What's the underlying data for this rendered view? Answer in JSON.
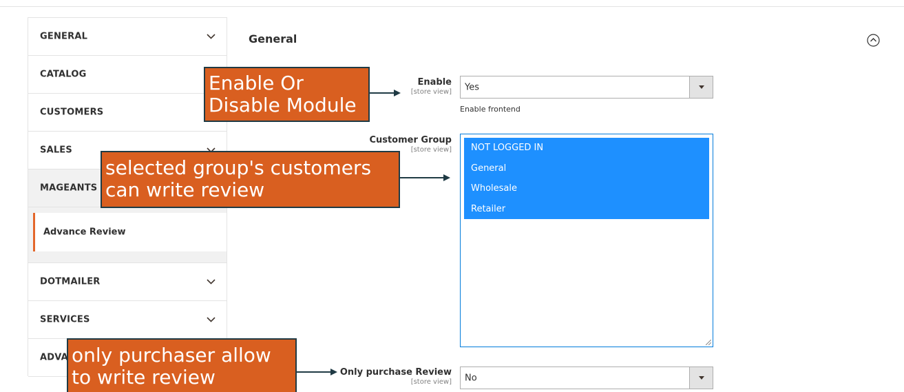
{
  "sidebar": {
    "items": [
      {
        "label": "GENERAL"
      },
      {
        "label": "CATALOG"
      },
      {
        "label": "CUSTOMERS"
      },
      {
        "label": "SALES"
      },
      {
        "label": "MAGEANTS"
      },
      {
        "label": "Advance Review"
      },
      {
        "label": "DOTMAILER"
      },
      {
        "label": "SERVICES"
      },
      {
        "label": "ADVA"
      }
    ]
  },
  "main": {
    "section_title": "General",
    "fields": {
      "enable": {
        "label": "Enable",
        "scope": "[store view]",
        "value": "Yes",
        "note": "Enable frontend"
      },
      "customer_group": {
        "label": "Customer Group",
        "scope": "[store view]",
        "options": [
          "NOT LOGGED IN",
          "General",
          "Wholesale",
          "Retailer"
        ]
      },
      "only_purchase_review": {
        "label": "Only purchase Review",
        "scope": "[store view]",
        "value": "No"
      }
    }
  },
  "annotations": {
    "enable": [
      "Enable Or",
      "Disable Module"
    ],
    "customer_group": [
      "selected group's customers",
      "can write review"
    ],
    "purchase": [
      "only purchaser allow",
      "to write review"
    ]
  },
  "colors": {
    "accent": "#e3662a",
    "selected_option": "#1e90ff",
    "callout_fill": "#d95f20",
    "callout_border": "#1f3a44"
  }
}
